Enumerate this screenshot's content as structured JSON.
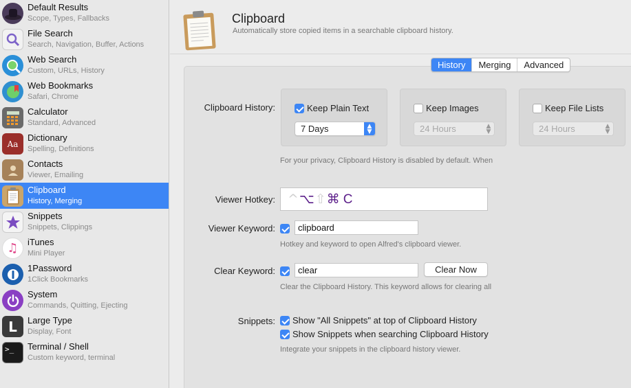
{
  "sidebar": {
    "items": [
      {
        "title": "Default Results",
        "subtitle": "Scope, Types, Fallbacks",
        "icon": "alfred-hat-icon",
        "color": "#4a3b5a"
      },
      {
        "title": "File Search",
        "subtitle": "Search, Navigation, Buffer, Actions",
        "icon": "magnifier-icon",
        "color": "#7d63c9"
      },
      {
        "title": "Web Search",
        "subtitle": "Custom, URLs, History",
        "icon": "globe-search-icon",
        "color": "#2a8fd8"
      },
      {
        "title": "Web Bookmarks",
        "subtitle": "Safari, Chrome",
        "icon": "globe-bookmark-icon",
        "color": "#2f8fd0"
      },
      {
        "title": "Calculator",
        "subtitle": "Standard, Advanced",
        "icon": "calculator-icon",
        "color": "#6a6a6a"
      },
      {
        "title": "Dictionary",
        "subtitle": "Spelling, Definitions",
        "icon": "dictionary-icon",
        "color": "#9a2e2a"
      },
      {
        "title": "Contacts",
        "subtitle": "Viewer, Emailing",
        "icon": "contacts-icon",
        "color": "#a6825a"
      },
      {
        "title": "Clipboard",
        "subtitle": "History, Merging",
        "icon": "clipboard-icon",
        "color": "#caa56b"
      },
      {
        "title": "Snippets",
        "subtitle": "Snippets, Clippings",
        "icon": "snippets-star-icon",
        "color": "#7b4cc1"
      },
      {
        "title": "iTunes",
        "subtitle": "Mini Player",
        "icon": "music-note-icon",
        "color": "#e04a8c"
      },
      {
        "title": "1Password",
        "subtitle": "1Click Bookmarks",
        "icon": "onepassword-icon",
        "color": "#1b5fae"
      },
      {
        "title": "System",
        "subtitle": "Commands, Quitting, Ejecting",
        "icon": "power-icon",
        "color": "#8a3fc3"
      },
      {
        "title": "Large Type",
        "subtitle": "Display, Font",
        "icon": "large-type-icon",
        "color": "#3a3a3a"
      },
      {
        "title": "Terminal / Shell",
        "subtitle": "Custom keyword, terminal",
        "icon": "terminal-icon",
        "color": "#1a1a1a"
      }
    ],
    "selected_index": 7,
    "accent": "#3d86f5"
  },
  "header": {
    "title": "Clipboard",
    "subtitle": "Automatically store copied items in a searchable clipboard history.",
    "icon": "clipboard-icon"
  },
  "tabs": [
    {
      "label": "History",
      "active": true
    },
    {
      "label": "Merging",
      "active": false
    },
    {
      "label": "Advanced",
      "active": false
    }
  ],
  "history": {
    "label": "Clipboard History:",
    "plain_text": {
      "label": "Keep Plain Text",
      "checked": true,
      "duration": "7 Days"
    },
    "images": {
      "label": "Keep Images",
      "checked": false,
      "duration": "24 Hours"
    },
    "file_lists": {
      "label": "Keep File Lists",
      "checked": false,
      "duration": "24 Hours"
    },
    "note": "For your privacy, Clipboard History is disabled by default. When"
  },
  "viewer_hotkey": {
    "label": "Viewer Hotkey:",
    "ctrl": "^",
    "opt": "⌥",
    "shift": "⇧",
    "cmd": "⌘",
    "key": "C"
  },
  "viewer_keyword": {
    "label": "Viewer Keyword:",
    "checked": true,
    "value": "clipboard",
    "note": "Hotkey and keyword to open Alfred's clipboard viewer."
  },
  "clear_keyword": {
    "label": "Clear Keyword:",
    "checked": true,
    "value": "clear",
    "button": "Clear Now",
    "note": "Clear the Clipboard History. This keyword allows for clearing all"
  },
  "snippets": {
    "label": "Snippets:",
    "option1": {
      "label": "Show \"All Snippets\" at top of Clipboard History",
      "checked": true
    },
    "option2": {
      "label": "Show Snippets when searching Clipboard History",
      "checked": true
    },
    "note": "Integrate your snippets in the clipboard history viewer."
  }
}
